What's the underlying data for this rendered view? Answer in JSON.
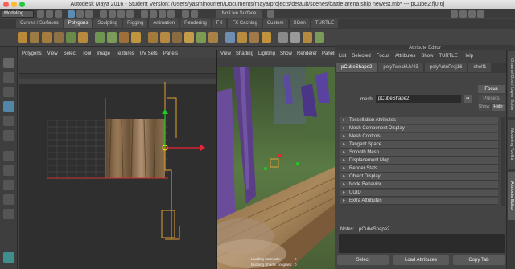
{
  "window": {
    "title": "Autodesk Maya 2016 - Student Version: /Users/yasminourren/Documents/maya/projects/default/scenes/battle arena ship newest.mb* --- pCube2.f[0:6]"
  },
  "statusline": {
    "menuset": "Modeling",
    "live_surface": "No Live Surface"
  },
  "shelf": {
    "tabs": [
      "Curves / Surfaces",
      "Polygons",
      "Sculpting",
      "Rigging",
      "Animation",
      "Rendering",
      "FX",
      "FX Caching",
      "Custom",
      "XGen",
      "TURTLE"
    ],
    "active_tab": "Polygons"
  },
  "uv_editor": {
    "menu": [
      "Polygons",
      "View",
      "Select",
      "Tool",
      "Image",
      "Textures",
      "UV Sets",
      "Panels"
    ]
  },
  "viewport": {
    "menu": [
      "View",
      "Shading",
      "Lighting",
      "Show",
      "Renderer",
      "Panels"
    ],
    "hud": [
      "Loading Materials:",
      "Building Shader program:"
    ],
    "hud_values": [
      "0",
      "0"
    ]
  },
  "attribute_editor": {
    "header": "Attribute Editor",
    "menu": [
      "List",
      "Selected",
      "Focus",
      "Attributes",
      "Show",
      "TURTLE",
      "Help"
    ],
    "tabs": [
      "pCubeShape2",
      "polyTweakUV43",
      "polyAutoProj16",
      "shelf1"
    ],
    "active_tab": "pCubeShape2",
    "mesh_label": "mesh:",
    "mesh_value": "pCubeShape2",
    "buttons": {
      "focus": "Focus",
      "presets": "Presets",
      "show": "Show",
      "hide": "Hide"
    },
    "sections": [
      "Tessellation Attributes",
      "Mesh Component Display",
      "Mesh Controls",
      "Tangent Space",
      "Smooth Mesh",
      "Displacement Map",
      "Render Stats",
      "Object Display",
      "Node Behavior",
      "UUID",
      "Extra Attributes"
    ],
    "notes_label": "Notes:",
    "notes_value": "pCubeShape2",
    "bottom_buttons": [
      "Select",
      "Load Attributes",
      "Copy Tab"
    ]
  },
  "side_tabs": [
    "Channel Box / Layer Editor",
    "Modeling Toolkit",
    "Attribute Editor"
  ],
  "colors": {
    "accent": "#5285a6",
    "active_tab": "#5a5a5a",
    "panel": "#444444"
  }
}
